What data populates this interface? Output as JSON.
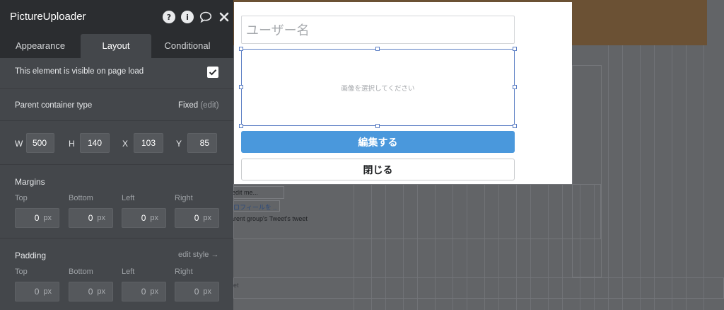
{
  "panel": {
    "title": "PictureUploader",
    "icons": [
      "help-icon",
      "info-icon",
      "comment-icon",
      "close-icon"
    ],
    "tabs": [
      "Appearance",
      "Layout",
      "Conditional"
    ],
    "active_tab": "Layout",
    "visible_label": "This element is visible on page load",
    "visible_checked": true,
    "parent_container_label": "Parent container type",
    "parent_container_value": "Fixed",
    "parent_container_edit": "(edit)",
    "position": {
      "w_label": "W",
      "w": "500",
      "h_label": "H",
      "h": "140",
      "x_label": "X",
      "x": "103",
      "y_label": "Y",
      "y": "85"
    },
    "margins": {
      "title": "Margins",
      "top_label": "Top",
      "bottom_label": "Bottom",
      "left_label": "Left",
      "right_label": "Right",
      "top": "0",
      "bottom": "0",
      "left": "0",
      "right": "0",
      "unit": "px"
    },
    "padding": {
      "title": "Padding",
      "edit_style": "edit style →",
      "top_label": "Top",
      "bottom_label": "Bottom",
      "left_label": "Left",
      "right_label": "Right",
      "top": "0",
      "bottom": "0",
      "left": "0",
      "right": "0",
      "unit": "px"
    }
  },
  "popup": {
    "username_placeholder": "ユーザー名",
    "uploader_text": "画像を選択してください",
    "edit_button": "編集する",
    "close_button": "閉じる"
  },
  "background": {
    "edit_text": "edit me...",
    "profile_link": "ロフィールを ..",
    "tweet_text": "arent group's Tweet's tweet",
    "stray_text": "et"
  },
  "colors": {
    "panel_bg": "#44474b",
    "titlebar_bg": "#2b2d30",
    "primary_button": "#4a98dc",
    "selection": "#5b7ec4",
    "canvas_orange": "#6b5134"
  }
}
